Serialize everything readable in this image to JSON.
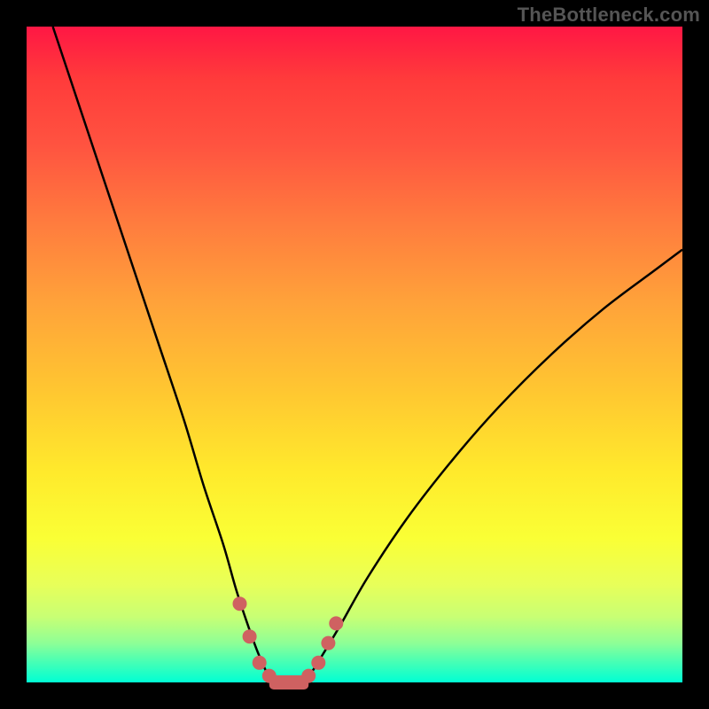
{
  "watermark": "TheBottleneck.com",
  "colors": {
    "curve": "#000000",
    "marker": "#cf6161",
    "background_top": "#ff1744",
    "background_bottom": "#00ffd4",
    "frame": "#000000"
  },
  "chart_data": {
    "type": "line",
    "title": "",
    "xlabel": "",
    "ylabel": "",
    "xlim": [
      0,
      100
    ],
    "ylim": [
      0,
      100
    ],
    "grid": false,
    "series": [
      {
        "name": "bottleneck-curve",
        "x": [
          4,
          8,
          12,
          16,
          20,
          24,
          27,
          30,
          32,
          34,
          35.5,
          37,
          39,
          41,
          43,
          45,
          48,
          52,
          58,
          65,
          72,
          80,
          88,
          96,
          100
        ],
        "y": [
          100,
          88,
          76,
          64,
          52,
          40,
          30,
          21,
          14,
          8,
          4,
          1,
          0,
          0,
          1,
          4,
          9,
          16,
          25,
          34,
          42,
          50,
          57,
          63,
          66
        ]
      }
    ],
    "markers": {
      "name": "highlighted-points",
      "x": [
        32.5,
        34,
        35.5,
        37,
        39,
        41,
        43,
        44.5,
        46,
        47.2
      ],
      "y": [
        12,
        7,
        3,
        1,
        0,
        0,
        1,
        3,
        6,
        9
      ]
    },
    "marker_bar": {
      "x_start": 37,
      "x_end": 43,
      "y": 0,
      "thickness": 2
    }
  }
}
